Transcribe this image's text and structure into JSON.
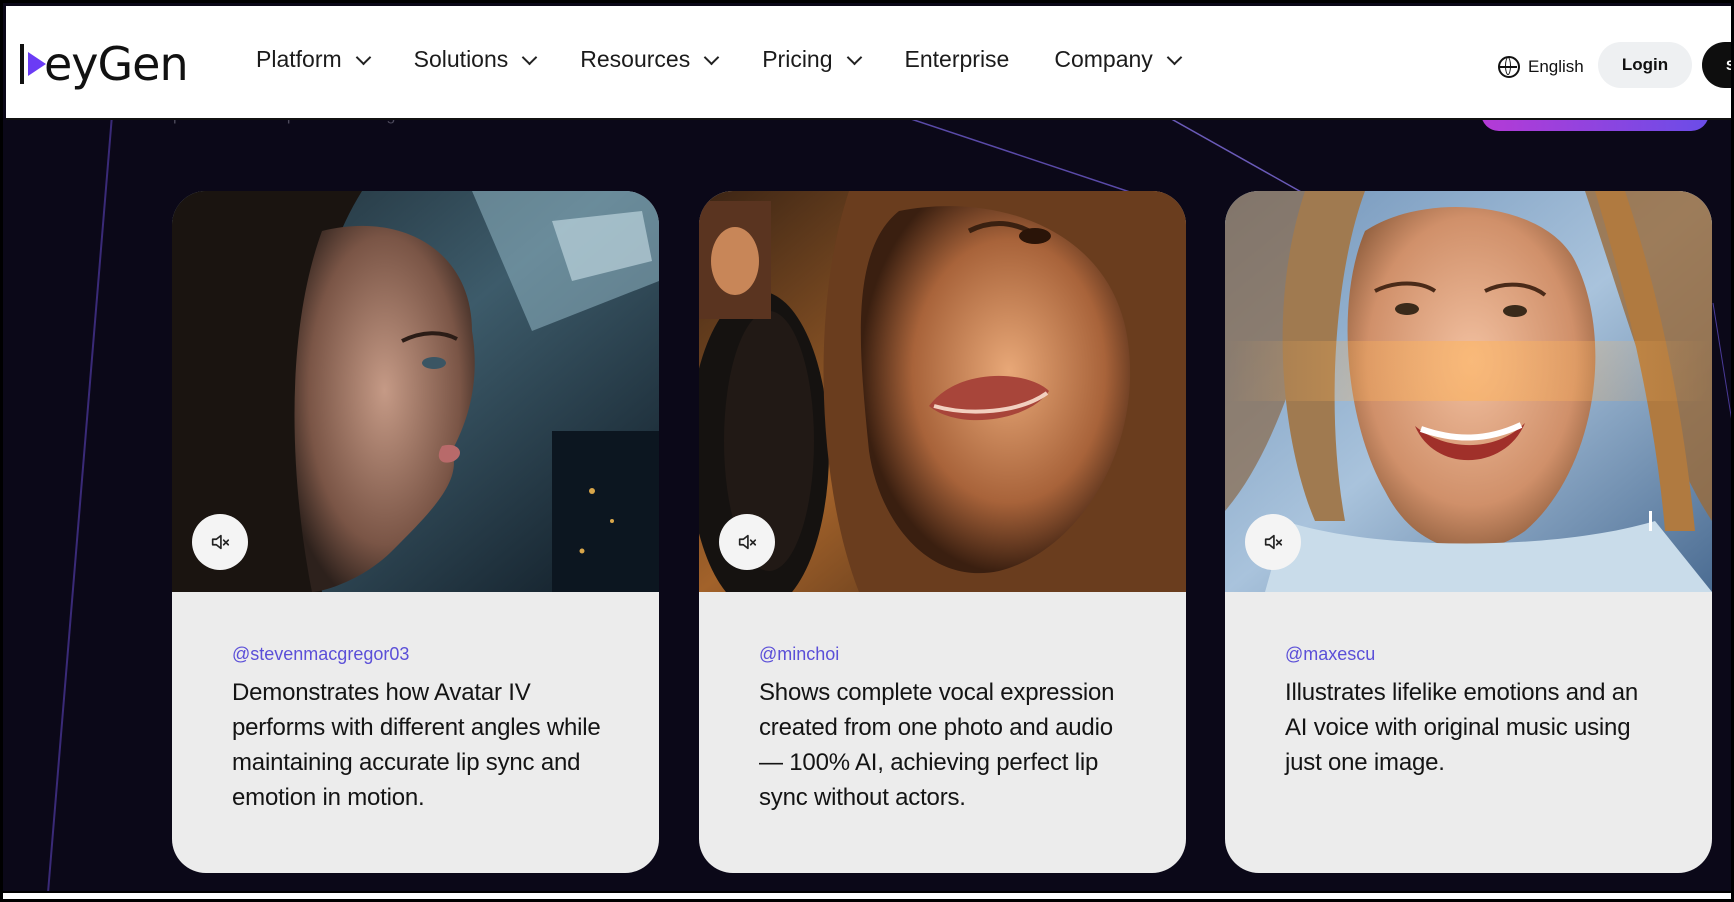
{
  "header": {
    "logo_text": "HeyGen",
    "nav": [
      {
        "label": "Platform",
        "dropdown": true
      },
      {
        "label": "Solutions",
        "dropdown": true
      },
      {
        "label": "Resources",
        "dropdown": true
      },
      {
        "label": "Pricing",
        "dropdown": true
      },
      {
        "label": "Enterprise",
        "dropdown": false
      },
      {
        "label": "Company",
        "dropdown": true
      }
    ],
    "language": "English",
    "login_label": "Login",
    "signup_label": "S"
  },
  "hero": {
    "partial_text": "photo and a script into stunning animations."
  },
  "cards": [
    {
      "handle": "@stevenmacgregor03",
      "description": "Demonstrates how Avatar IV performs with different angles while maintaining accurate lip sync and emotion in motion.",
      "icon": "mute-icon"
    },
    {
      "handle": "@minchoi",
      "description": "Shows complete vocal expression created from one photo and audio — 100% AI, achieving perfect lip sync without actors.",
      "icon": "mute-icon"
    },
    {
      "handle": "@maxescu",
      "description": "Illustrates lifelike emotions and an AI voice with original music using just one image.",
      "icon": "mute-icon"
    }
  ],
  "colors": {
    "background": "#0b0818",
    "brand_purple": "#6b3cf5",
    "handle": "#5b4fd8",
    "card_bg": "#ececec"
  }
}
